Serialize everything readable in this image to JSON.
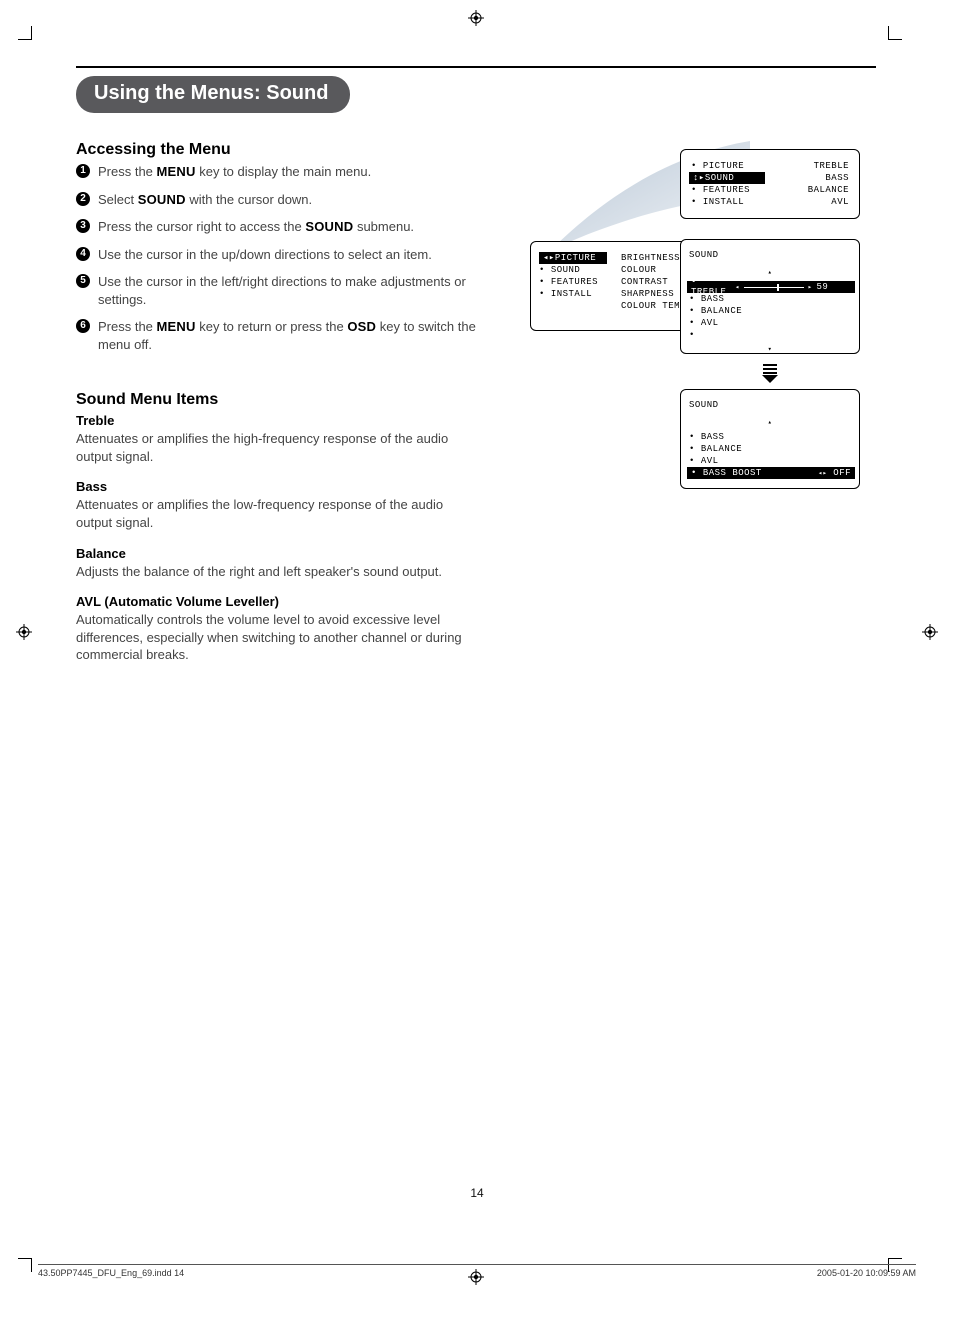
{
  "title": "Using the Menus: Sound",
  "section_accessing_heading": "Accessing the Menu",
  "steps": [
    "Press the <b>MENU</b> key to display the main menu.",
    "Select <b>SOUND</b> with the cursor down.",
    "Press the cursor right to access the <b>SOUND</b> submenu.",
    "Use the cursor in the up/down directions to select an item.",
    "Use the cursor in the left/right directions to make adjustments or settings.",
    "Press the <b>MENU</b> key to return or press the <b>OSD</b> key to switch the menu off."
  ],
  "section_items_heading": "Sound Menu Items",
  "items": [
    {
      "name": "Treble",
      "desc": "Attenuates or amplifies the high-frequency response of the audio output signal."
    },
    {
      "name": "Bass",
      "desc": "Attenuates or amplifies the low-frequency response of the audio output signal."
    },
    {
      "name": "Balance",
      "desc": "Adjusts the balance of the right and left speaker's sound output."
    },
    {
      "name": "AVL (Automatic Volume Leveller)",
      "desc": "Automatically controls the volume level to avoid excessive level differences, especially when switching to another channel or during commercial breaks."
    }
  ],
  "osd1": {
    "left": [
      "PICTURE",
      "SOUND",
      "FEATURES",
      "INSTALL"
    ],
    "right": [
      "TREBLE",
      "BASS",
      "BALANCE",
      "AVL"
    ],
    "highlight_index": 1,
    "highlight_prefix": "↕▸"
  },
  "osd2": {
    "left": [
      "PICTURE",
      "SOUND",
      "FEATURES",
      "INSTALL"
    ],
    "right": [
      "BRIGHTNESS",
      "COLOUR",
      "CONTRAST",
      "SHARPNESS",
      "COLOUR TEMP"
    ],
    "highlight_index": 0,
    "highlight_prefix": "◂▸"
  },
  "osd3": {
    "title": "SOUND",
    "rows": [
      "TREBLE",
      "BASS",
      "BALANCE",
      "AVL"
    ],
    "highlight_index": 0,
    "value": "59",
    "left_caret": "◂",
    "right_caret": "▸",
    "up_caret": "▴",
    "down_caret": "▾"
  },
  "osd4": {
    "title": "SOUND",
    "rows": [
      "BASS",
      "BALANCE",
      "AVL",
      "BASS BOOST"
    ],
    "highlight_index": 3,
    "highlight_value": "OFF",
    "left_caret": "◂▸",
    "up_caret": "▴"
  },
  "page_number": "14",
  "footer_left": "43.50PP7445_DFU_Eng_69.indd   14",
  "footer_right": "2005-01-20   10:09:59 AM"
}
